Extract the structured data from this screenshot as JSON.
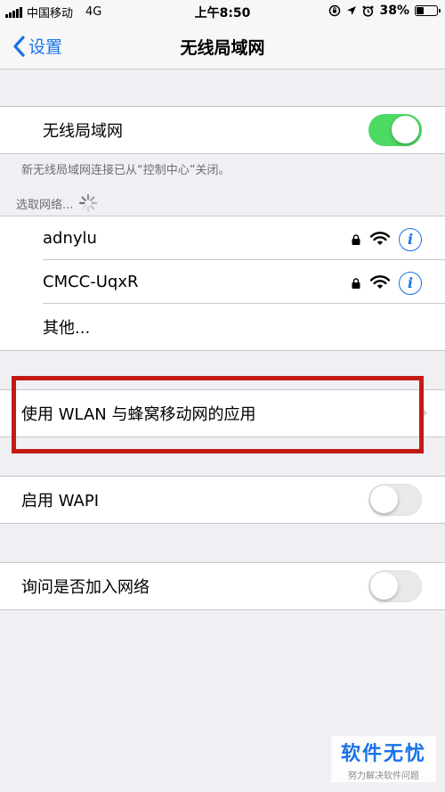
{
  "status": {
    "carrier": "中国移动",
    "network": "4G",
    "time": "上午8:50",
    "battery": "38%",
    "battery_level": 0.38
  },
  "nav": {
    "back_label": "设置",
    "title": "无线局域网"
  },
  "wlan": {
    "label": "无线局域网",
    "enabled": true,
    "footnote": "新无线局域网连接已从“控制中心”关闭。"
  },
  "networks": {
    "header": "选取网络...",
    "items": [
      {
        "name": "adnylu",
        "secured": true,
        "info": "i"
      },
      {
        "name": "CMCC-UqxR",
        "secured": true,
        "info": "i"
      }
    ],
    "other": "其他..."
  },
  "apps_row": {
    "label": "使用 WLAN 与蜂窝移动网的应用"
  },
  "wapi": {
    "label": "启用 WAPI",
    "enabled": false
  },
  "ask_join": {
    "label": "询问是否加入网络",
    "enabled": false
  },
  "watermark": {
    "title": "软件无忧",
    "subtitle": "努力解决软件问题"
  },
  "colors": {
    "accent": "#1a73e8",
    "toggle_on": "#4cd964",
    "highlight": "#c41a16",
    "background": "#efeff4"
  }
}
